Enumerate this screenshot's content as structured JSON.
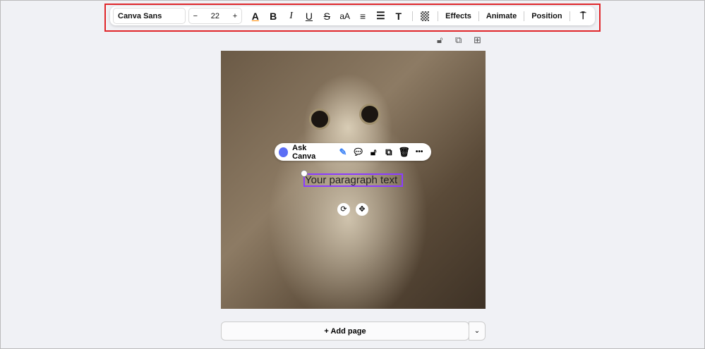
{
  "toolbar": {
    "font": "Canva Sans",
    "minus": "−",
    "size": "22",
    "plus": "+",
    "text_color": "A",
    "bold": "B",
    "italic": "I",
    "underline": "U",
    "strike": "S",
    "case": "aA",
    "effects": "Effects",
    "animate": "Animate",
    "position": "Position"
  },
  "page_actions": {
    "lock": "lock-icon",
    "duplicate": "duplicate-icon",
    "add": "add-page-icon"
  },
  "context_menu": {
    "ask_canva": "Ask Canva",
    "more": "•••"
  },
  "canvas": {
    "text": "Your paragraph text"
  },
  "footer": {
    "add_page": "+ Add page",
    "chevron": "⌄"
  },
  "colors": {
    "selection": "#8b3dff",
    "highlight": "#e0262a"
  }
}
